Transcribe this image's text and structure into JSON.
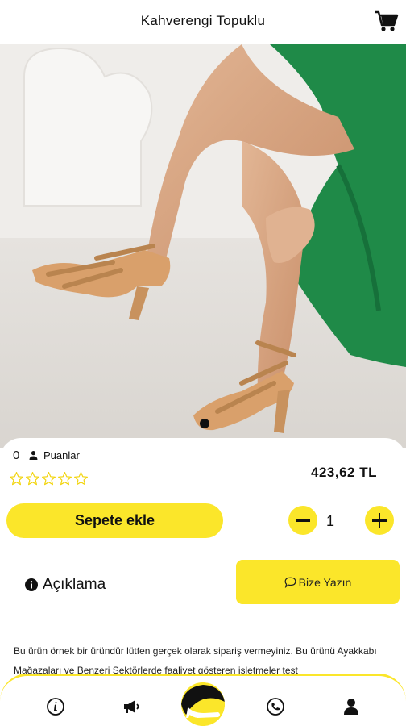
{
  "header": {
    "title": "Kahverengi Topuklu",
    "cart_icon": "shopping-cart-icon"
  },
  "product": {
    "image_alt": "shoe-photo",
    "rating_count": "0",
    "rating_label": "Puanlar",
    "stars_filled": 0,
    "stars_total": 5,
    "price": "423,62 TL"
  },
  "actions": {
    "add_to_cart": "Sepete ekle",
    "quantity": "1",
    "minus_icon": "minus-icon",
    "plus_icon": "plus-icon"
  },
  "tabs": {
    "description": "Açıklama",
    "write_us": "Bize Yazın"
  },
  "description_text": "Bu ürün örnek bir üründür lütfen gerçek olarak sipariş vermeyiniz. Bu ürünü Ayakkabı Mağazaları ve Benzeri Sektörlerde faaliyet gösteren işletmeler test",
  "bottom_nav": {
    "items": [
      "info-icon",
      "megaphone-icon",
      "home-logo-icon",
      "phone-icon",
      "user-icon"
    ]
  },
  "colors": {
    "accent": "#fbe62a",
    "dress": "#1f8a48"
  }
}
